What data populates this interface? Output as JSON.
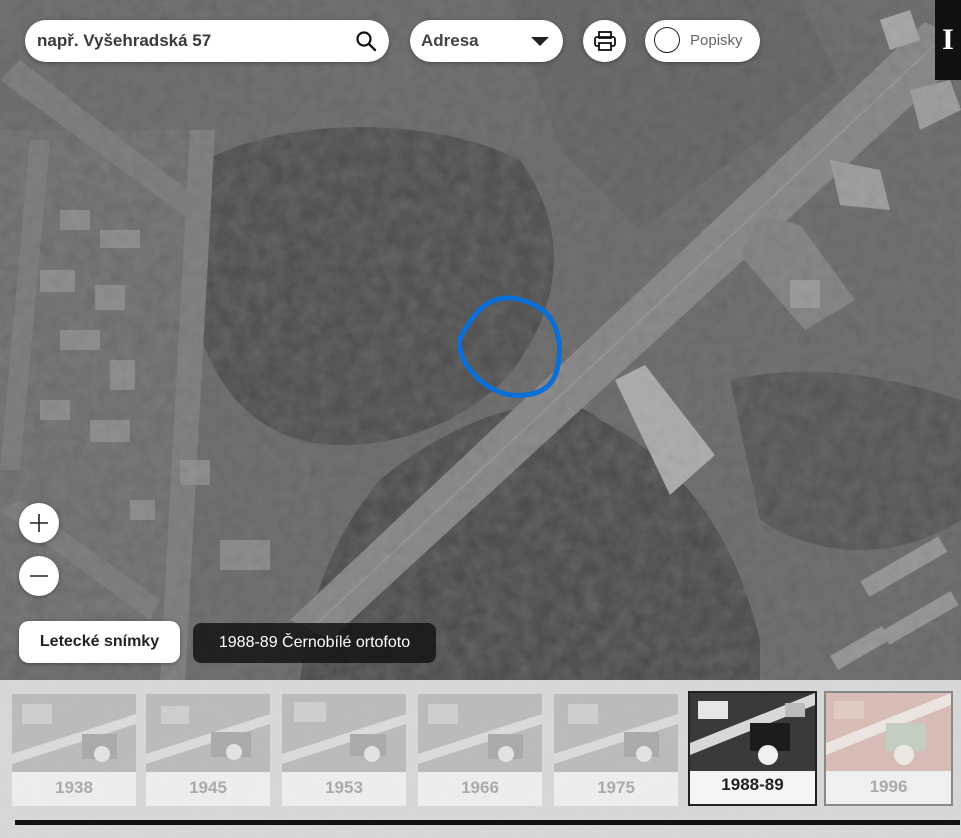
{
  "search": {
    "placeholder": "např. Vyšehradská 57",
    "icon": "search-icon"
  },
  "search_type": {
    "selected": "Adresa"
  },
  "toolbar": {
    "print_icon": "printer-icon",
    "labels_toggle": "Popisky",
    "info_label": "I"
  },
  "zoom": {
    "in_icon": "plus-icon",
    "out_icon": "minus-icon"
  },
  "layers": {
    "button_label": "Letecké snímky",
    "current_label": "1988-89 Černobílé ortofoto"
  },
  "timeline": {
    "items": [
      {
        "year": "1938",
        "state": "faded"
      },
      {
        "year": "1945",
        "state": "faded"
      },
      {
        "year": "1953",
        "state": "faded"
      },
      {
        "year": "1966",
        "state": "faded"
      },
      {
        "year": "1975",
        "state": "faded"
      },
      {
        "year": "1988-89",
        "state": "active"
      },
      {
        "year": "1996",
        "state": "faded"
      }
    ]
  },
  "colors": {
    "highlight": "#0a6fd6",
    "panel": "#ffffff",
    "dark": "#141414"
  }
}
